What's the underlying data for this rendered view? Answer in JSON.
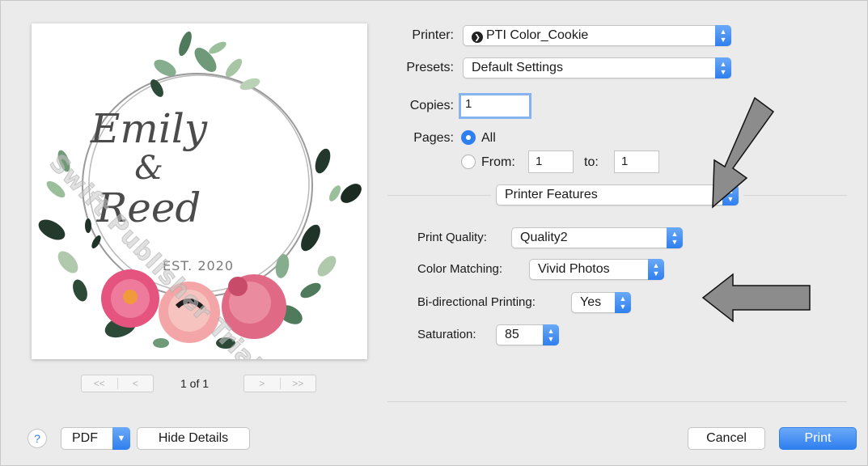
{
  "preview": {
    "names": [
      "Emily",
      "&",
      "Reed"
    ],
    "est": "EST. 2020",
    "watermark": "Swift Publisher Trial Version",
    "pager_first": "<<",
    "pager_prev": "<",
    "pager_next": ">",
    "pager_last": ">>",
    "page_info": "1 of 1"
  },
  "printer": {
    "label": "Printer:",
    "value": "PTI Color_Cookie"
  },
  "presets": {
    "label": "Presets:",
    "value": "Default Settings"
  },
  "copies": {
    "label": "Copies:",
    "value": "1"
  },
  "pages": {
    "label": "Pages:",
    "all_label": "All",
    "from_label": "From:",
    "from_value": "1",
    "to_label": "to:",
    "to_value": "1",
    "selected": "All"
  },
  "section": {
    "value": "Printer Features"
  },
  "features": [
    {
      "label": "Print Quality:",
      "value": "Quality2"
    },
    {
      "label": "Color Matching:",
      "value": "Vivid Photos"
    },
    {
      "label": "Bi-directional Printing:",
      "value": "Yes"
    },
    {
      "label": "Saturation:",
      "value": "85"
    }
  ],
  "bottom": {
    "help": "?",
    "pdf": "PDF",
    "hide_details": "Hide Details",
    "cancel": "Cancel",
    "print": "Print"
  },
  "colors": {
    "accent": "#2f7fef",
    "arrow": "#8c8c8c"
  }
}
